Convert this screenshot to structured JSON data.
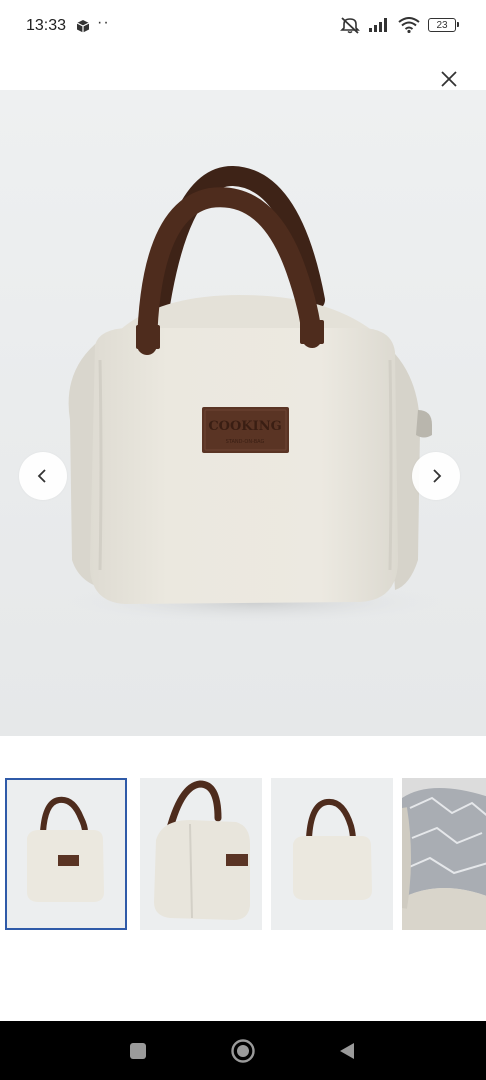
{
  "status_bar": {
    "time": "13:33",
    "dots": "··",
    "battery": "23",
    "icons": [
      "package-icon",
      "mute-icon",
      "signal-icon",
      "wifi-icon",
      "battery-icon"
    ]
  },
  "gallery": {
    "close_icon": "close-icon",
    "prev_icon": "chevron-left-icon",
    "next_icon": "chevron-right-icon",
    "bag_label_main": "COOKING",
    "bag_label_sub": "STAND-ON-BAG",
    "thumbnail_count_visible": 4,
    "selected_thumbnail": 1
  },
  "navigation_bar": {
    "icons": [
      "recent-apps-icon",
      "home-icon",
      "back-icon"
    ]
  },
  "colors": {
    "bag_body": "#ebe8df",
    "handle_brown": "#4e2c1d",
    "active_thumb_border": "#2f5aa8",
    "background": "#e9ebec"
  }
}
